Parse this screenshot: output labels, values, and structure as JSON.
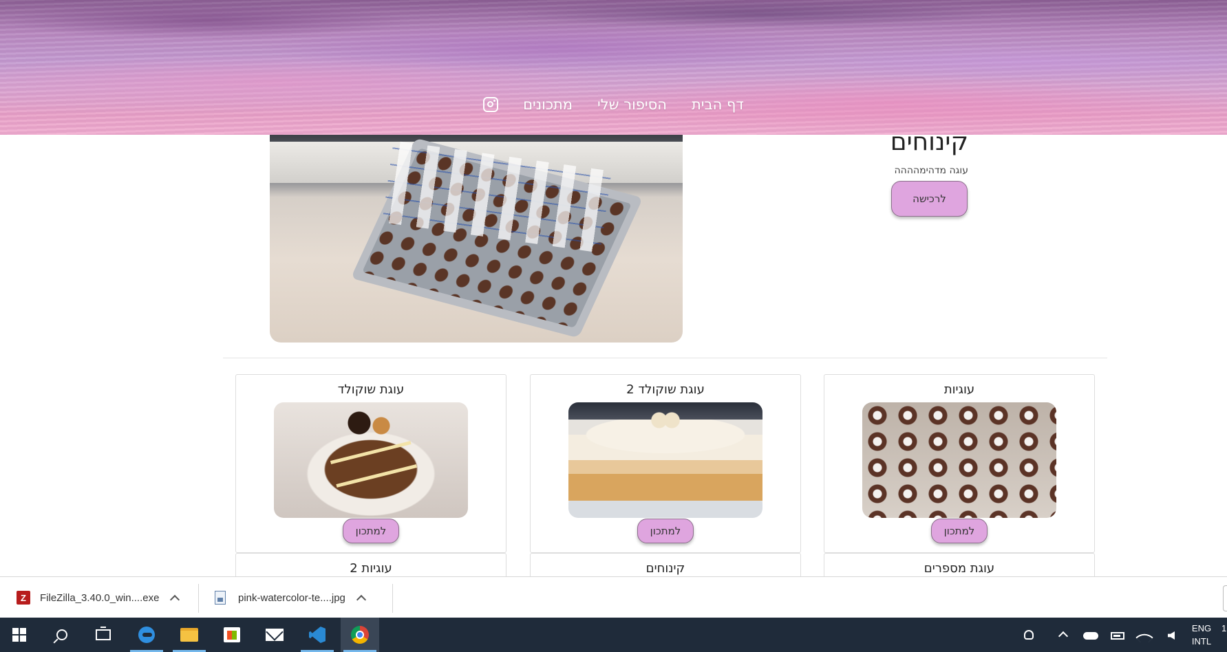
{
  "nav": {
    "items": [
      "דף הבית",
      "הסיפור שלי",
      "מתכונים"
    ],
    "instagram_icon": "instagram-icon"
  },
  "featured": {
    "title": "קינוחים",
    "subtitle": "עוגה מדהימהההה",
    "button": "לרכישה"
  },
  "cards": [
    {
      "title": "עוגיות",
      "button": "למתכון"
    },
    {
      "title": "עוגת שוקולד 2",
      "button": "למתכון"
    },
    {
      "title": "עוגת שוקולד",
      "button": "למתכון"
    }
  ],
  "cards_next_row": [
    "עוגת מספרים",
    "קינוחים",
    "עוגיות 2"
  ],
  "downloads": [
    {
      "name": "FileZilla_3.40.0_win....exe",
      "icon": "filezilla-icon"
    },
    {
      "name": "pink-watercolor-te....jpg",
      "icon": "jpg-file-icon"
    }
  ],
  "taskbar": {
    "lang_line1": "ENG",
    "lang_line2": "INTL",
    "clock_edge": "1"
  },
  "colors": {
    "button_pink": "#dfa5df",
    "taskbar": "#1f2b3a",
    "header_pink": "#e9a2c8"
  }
}
